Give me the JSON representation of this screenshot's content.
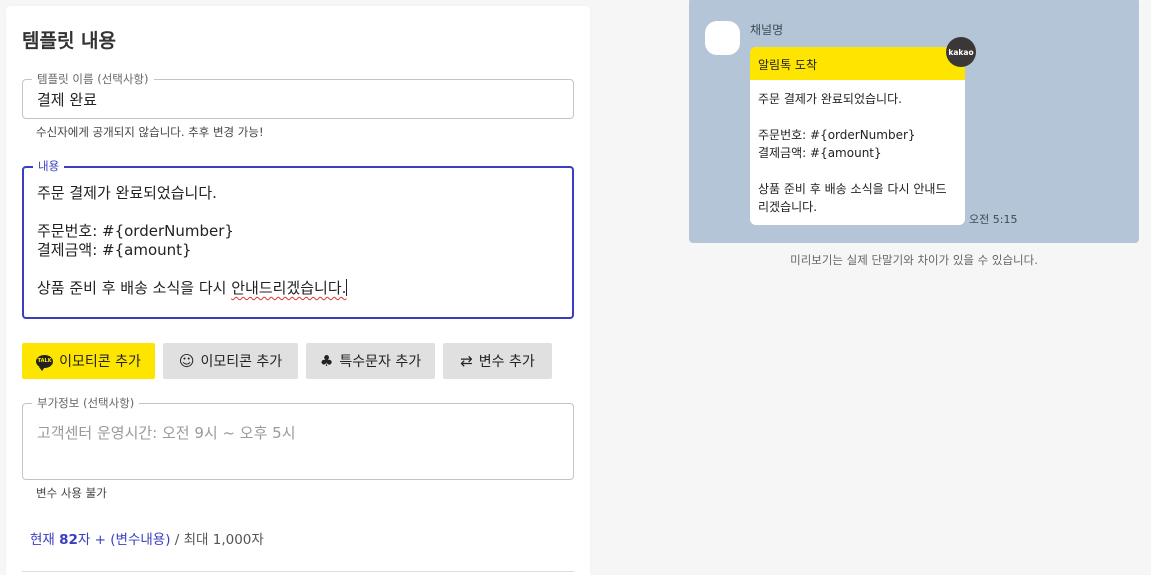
{
  "editor": {
    "title": "템플릿 내용",
    "template_name": {
      "legend": "템플릿 이름 (선택사항)",
      "value": "결제 완료",
      "helper": "수신자에게 공개되지 않습니다. 추후 변경 가능!"
    },
    "content": {
      "legend": "내용",
      "lines": [
        "주문 결제가 완료되었습니다.",
        "",
        "주문번호: #{orderNumber}",
        "결제금액: #{amount}",
        "",
        "상품 준비 후 배송 소식을 다시 ",
        "안내드리겠습니다."
      ]
    },
    "buttons": {
      "kakao_emoticon": "이모티콘 추가",
      "emoticon": "이모티콘 추가",
      "special_char": "특수문자 추가",
      "variable": "변수 추가"
    },
    "extra_info": {
      "legend": "부가정보 (선택사항)",
      "placeholder": "고객센터 운영시간: 오전 9시 ~ 오후 5시",
      "helper": "변수 사용 불가"
    },
    "char_count": {
      "prefix": "현재 ",
      "count": "82",
      "suffix": "자 + (변수내용)",
      "max": " / 최대 1,000자"
    }
  },
  "preview": {
    "channel_name": "채널명",
    "header": "알림톡 도착",
    "lines": [
      "주문 결제가 완료되었습니다.",
      "",
      "주문번호: #{orderNumber}",
      "결제금액: #{amount}",
      "",
      "상품 준비 후 배송 소식을 다시 안내드",
      "리겠습니다."
    ],
    "badge": "kakao",
    "time": "오전 5:15",
    "note": "미리보기는 실제 단말기와 차이가 있을 수 있습니다."
  },
  "icons": {
    "talk": "TALK",
    "emoticon": "☺",
    "special": "♣",
    "variable": "⇄"
  },
  "colors": {
    "accent": "#3a3fbf",
    "kakao_yellow": "#fee500",
    "preview_bg": "#b3c5d7"
  }
}
